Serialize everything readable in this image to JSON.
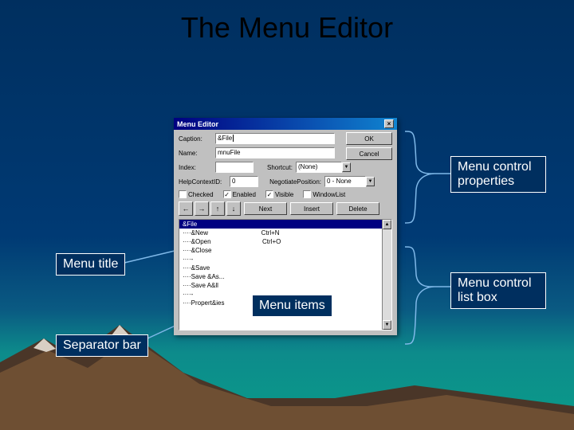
{
  "slide": {
    "title": "The Menu Editor"
  },
  "callouts": {
    "properties": "Menu control properties",
    "menutitle": "Menu title",
    "menuitems": "Menu items",
    "listbox": "Menu control list box",
    "separator": "Separator bar"
  },
  "dlg": {
    "title": "Menu Editor",
    "caption_lbl": "Caption:",
    "caption_val": "&File",
    "name_lbl": "Name:",
    "name_val": "mnuFile",
    "index_lbl": "Index:",
    "index_val": "",
    "shortcut_lbl": "Shortcut:",
    "shortcut_val": "(None)",
    "help_lbl": "HelpContextID:",
    "help_val": "0",
    "negpos_lbl": "NegotiatePosition:",
    "negpos_val": "0 - None",
    "ck_checked": "Checked",
    "ck_enabled": "Enabled",
    "ck_visible": "Visible",
    "ck_windowlist": "WindowList",
    "btn_ok": "OK",
    "btn_cancel": "Cancel",
    "btn_next": "Next",
    "btn_insert": "Insert",
    "btn_delete": "Delete",
    "arrows": {
      "left": "←",
      "right": "→",
      "up": "↑",
      "down": "↓"
    },
    "list": [
      {
        "text": "&File",
        "hotkey": "",
        "sel": true
      },
      {
        "text": "····&New",
        "hotkey": "Ctrl+N"
      },
      {
        "text": "····&Open",
        "hotkey": "Ctrl+O"
      },
      {
        "text": "····&Close",
        "hotkey": ""
      },
      {
        "text": "····-",
        "hotkey": ""
      },
      {
        "text": "····&Save",
        "hotkey": ""
      },
      {
        "text": "····Save &As...",
        "hotkey": ""
      },
      {
        "text": "····Save A&ll",
        "hotkey": ""
      },
      {
        "text": "····-",
        "hotkey": ""
      },
      {
        "text": "····Propert&ies",
        "hotkey": ""
      }
    ]
  }
}
